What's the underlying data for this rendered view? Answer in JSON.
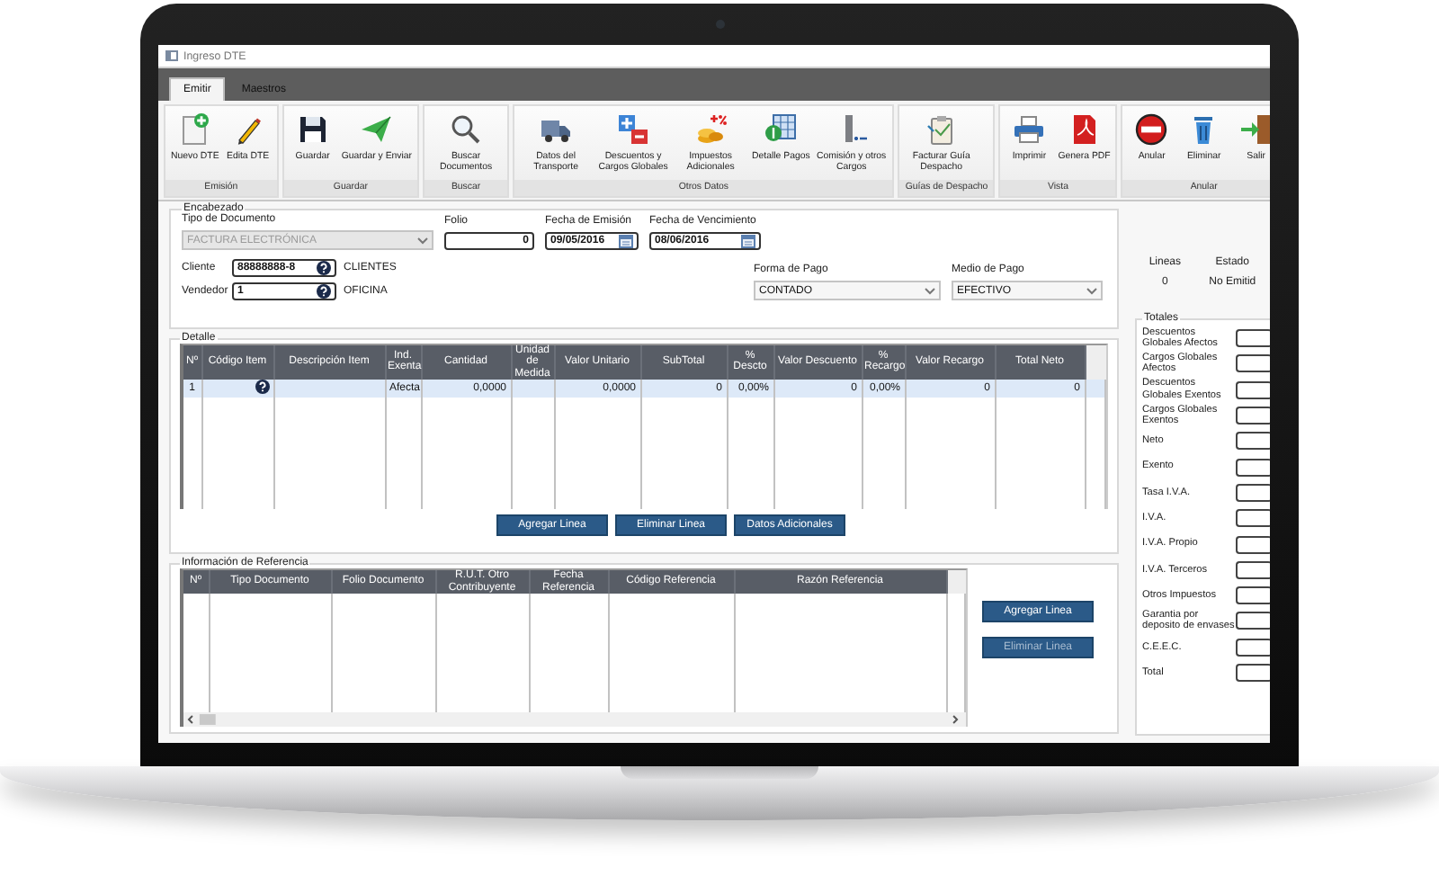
{
  "window": {
    "title": "Ingreso DTE"
  },
  "tabs": [
    {
      "label": "Emitir",
      "selected": true
    },
    {
      "label": "Maestros",
      "selected": false
    }
  ],
  "ribbon": [
    {
      "label": "Emisión",
      "buttons": [
        "Nuevo DTE",
        "Edita DTE"
      ]
    },
    {
      "label": "Guardar",
      "buttons": [
        "Guardar",
        "Guardar y Enviar"
      ]
    },
    {
      "label": "Buscar",
      "buttons": [
        "Buscar Documentos"
      ]
    },
    {
      "label": "Otros Datos",
      "buttons": [
        "Datos del Transporte",
        "Descuentos y Cargos Globales",
        "Impuestos Adicionales",
        "Detalle Pagos",
        "Comisión y otros Cargos"
      ]
    },
    {
      "label": "Guías de Despacho",
      "buttons": [
        "Facturar Guía Despacho"
      ]
    },
    {
      "label": "Vista",
      "buttons": [
        "Imprimir",
        "Genera PDF"
      ]
    },
    {
      "label": "Anular",
      "buttons": [
        "Anular",
        "Eliminar",
        "Salir"
      ]
    }
  ],
  "encabezado": {
    "title": "Encabezado",
    "tipo_documento": {
      "label": "Tipo de Documento",
      "value": "FACTURA ELECTRÓNICA",
      "disabled": true
    },
    "folio": {
      "label": "Folio",
      "value": "0"
    },
    "fecha_emision": {
      "label": "Fecha de Emisión",
      "value": "09/05/2016"
    },
    "fecha_vencimiento": {
      "label": "Fecha de Vencimiento",
      "value": "08/06/2016"
    },
    "cliente": {
      "label": "Cliente",
      "value": "88888888-8",
      "name": "CLIENTES"
    },
    "vendedor": {
      "label": "Vendedor",
      "value": "1",
      "name": "OFICINA"
    },
    "forma_pago": {
      "label": "Forma de Pago",
      "value": "CONTADO"
    },
    "medio_pago": {
      "label": "Medio de Pago",
      "value": "EFECTIVO"
    }
  },
  "status": {
    "lineas": {
      "label": "Lineas",
      "value": "0"
    },
    "estado": {
      "label": "Estado",
      "value": "No Emitid"
    }
  },
  "detalle": {
    "title": "Detalle",
    "columns": [
      {
        "label": "Nº",
        "kind": "index"
      },
      {
        "label": "Código Item",
        "kind": "lookup"
      },
      {
        "label": "Descripción Item",
        "kind": "text"
      },
      {
        "label": "Ind. Exenta",
        "kind": "text"
      },
      {
        "label": "Cantidad",
        "kind": "number"
      },
      {
        "label": "Unidad de Medida",
        "kind": "text"
      },
      {
        "label": "Valor Unitario",
        "kind": "number"
      },
      {
        "label": "SubTotal",
        "kind": "number"
      },
      {
        "label": "% Descto",
        "kind": "number"
      },
      {
        "label": "Valor Descuento",
        "kind": "number"
      },
      {
        "label": "% Recargo",
        "kind": "number"
      },
      {
        "label": "Valor Recargo",
        "kind": "number"
      },
      {
        "label": "Total Neto",
        "kind": "number"
      }
    ],
    "rows": [
      {
        "selected": true,
        "cells": [
          "1",
          null,
          null,
          "Afecta",
          "0,0000",
          null,
          "0,0000",
          "0",
          "0,00%",
          "0",
          "0,00%",
          "0",
          "0"
        ]
      }
    ],
    "buttons": [
      {
        "label": "Agregar Linea",
        "disabled": false
      },
      {
        "label": "Eliminar Linea",
        "disabled": false
      },
      {
        "label": "Datos Adicionales",
        "disabled": false
      }
    ]
  },
  "referencia": {
    "title": "Información de Referencia",
    "columns": [
      {
        "label": "Nº"
      },
      {
        "label": "Tipo Documento"
      },
      {
        "label": "Folio Documento"
      },
      {
        "label": "R.U.T. Otro Contribuyente"
      },
      {
        "label": "Fecha Referencia"
      },
      {
        "label": "Código Referencia"
      },
      {
        "label": "Razón Referencia"
      }
    ],
    "buttons": [
      {
        "label": "Agregar Linea",
        "disabled": false
      },
      {
        "label": "Eliminar Linea",
        "disabled": true
      }
    ]
  },
  "totales": {
    "title": "Totales",
    "items": [
      "Descuentos Globales Afectos",
      "Cargos Globales Afectos",
      "Descuentos Globales Exentos",
      "Cargos Globales Exentos",
      "Neto",
      "Exento",
      "Tasa I.V.A.",
      "I.V.A.",
      "I.V.A. Propio",
      "I.V.A. Terceros",
      "Otros Impuestos",
      "Garantia por deposito de envases",
      "C.E.E.C.",
      "Total"
    ]
  }
}
